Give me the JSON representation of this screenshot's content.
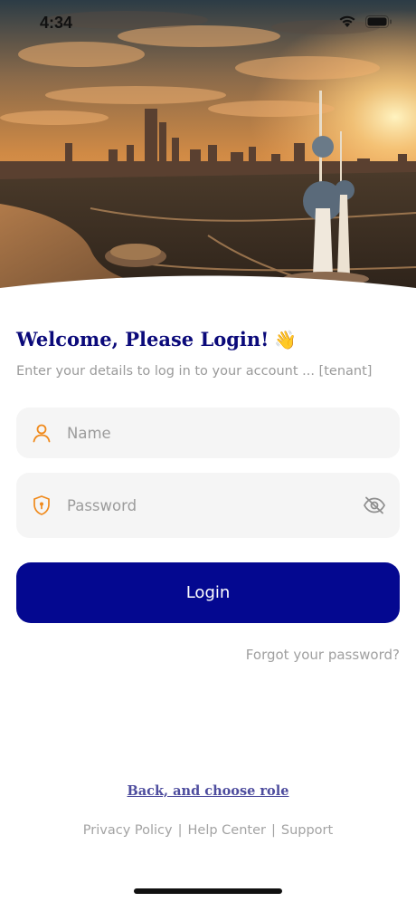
{
  "status_bar": {
    "time": "4:34"
  },
  "hero": {
    "image": "city-skyline-sunset"
  },
  "login": {
    "title": "Welcome, Please Login!",
    "title_emoji": "👋",
    "subtitle": "Enter your details to log in to your account ... [tenant]",
    "name_placeholder": "Name",
    "password_placeholder": "Password",
    "login_label": "Login",
    "forgot_label": "Forgot your password?",
    "back_label": "Back, and choose role"
  },
  "footer": {
    "links": [
      "Privacy Policy",
      "Help Center",
      "Support"
    ],
    "separator": "|"
  },
  "colors": {
    "primary": "#040890",
    "title": "#0b0a7a",
    "icon_accent": "#f08a1c",
    "muted": "#9a9a9a",
    "field_bg": "#f5f5f5"
  }
}
